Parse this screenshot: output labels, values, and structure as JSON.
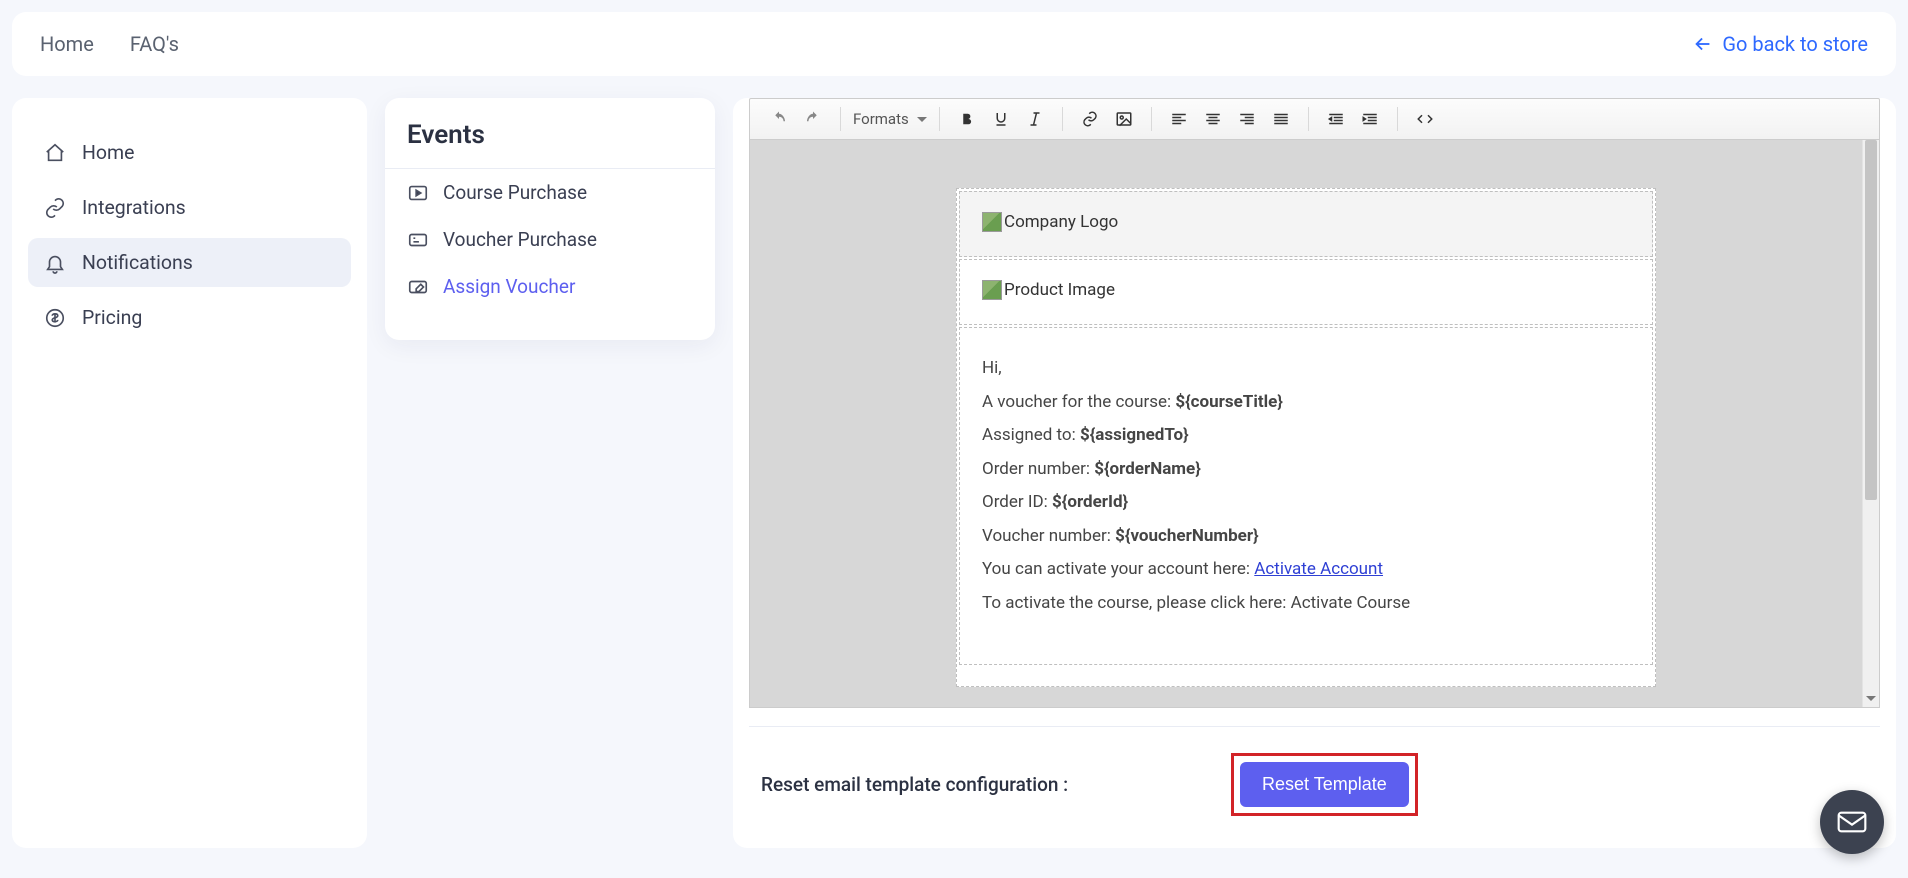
{
  "topbar": {
    "home": "Home",
    "faqs": "FAQ's",
    "go_back": "Go back to store"
  },
  "sidebar": {
    "items": [
      {
        "label": "Home"
      },
      {
        "label": "Integrations"
      },
      {
        "label": "Notifications"
      },
      {
        "label": "Pricing"
      }
    ]
  },
  "events": {
    "title": "Events",
    "items": [
      {
        "label": "Course Purchase"
      },
      {
        "label": "Voucher Purchase"
      },
      {
        "label": "Assign Voucher"
      }
    ]
  },
  "editor": {
    "formats_label": "Formats",
    "logo_alt": "Company Logo",
    "product_alt": "Product Image",
    "body": {
      "greeting": "Hi,",
      "course_line": "A voucher for the course: ",
      "course_var": "${courseTitle}",
      "assigned_line": "Assigned to: ",
      "assigned_var": "${assignedTo}",
      "ordernum_line": "Order number: ",
      "ordernum_var": "${orderName}",
      "orderid_line": "Order ID: ",
      "orderid_var": "${orderId}",
      "voucher_line": "Voucher number: ",
      "voucher_var": "${voucherNumber}",
      "activate_acc_line": "You can activate your account here: ",
      "activate_acc_link": "Activate Account",
      "activate_course_line": "To activate the course, please click here: Activate Course"
    }
  },
  "reset": {
    "label": "Reset email template configuration :",
    "button": "Reset Template"
  }
}
